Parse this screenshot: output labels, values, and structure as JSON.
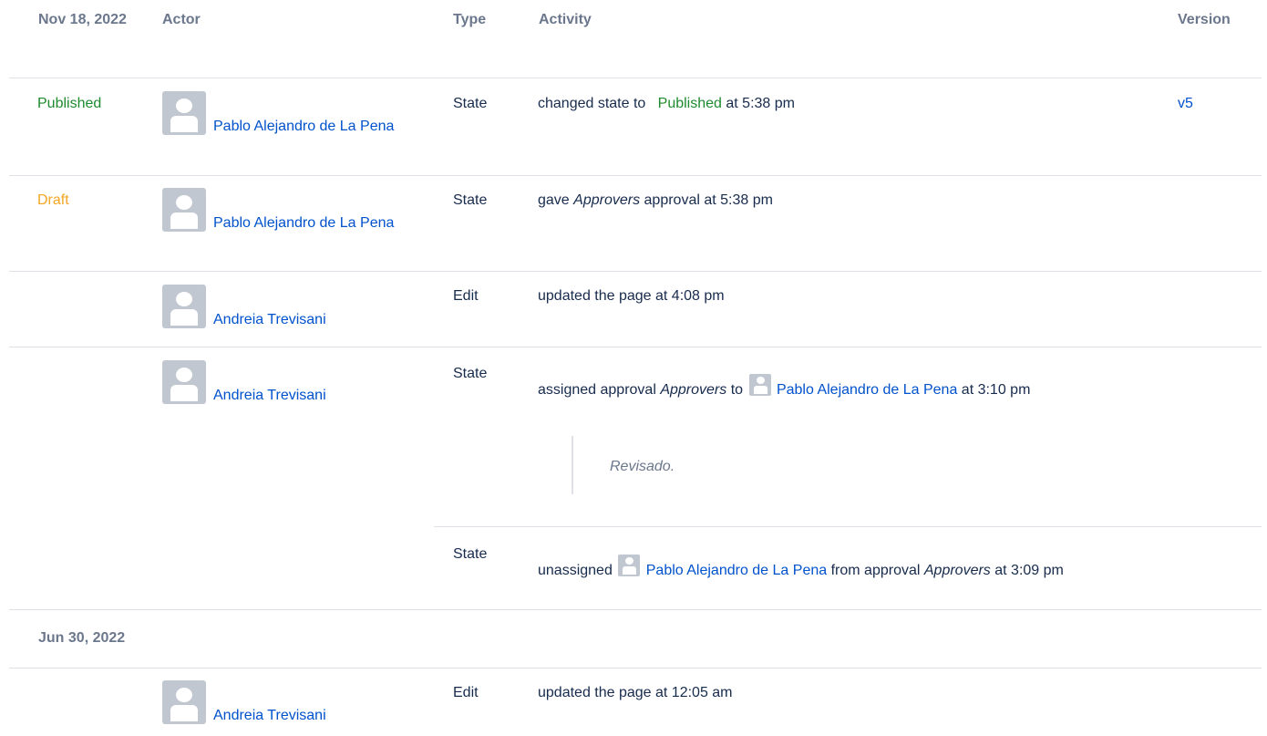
{
  "headers": {
    "date": "Nov 18, 2022",
    "actor": "Actor",
    "type": "Type",
    "activity": "Activity",
    "version": "Version"
  },
  "rows": [
    {
      "state": "Published",
      "actor": "Pablo Alejandro de La Pena",
      "type": "State",
      "activity_pre": "changed state to",
      "activity_state": "Published",
      "activity_post": "at 5:38 pm",
      "version": "v5"
    },
    {
      "state": "Draft",
      "actor": "Pablo Alejandro de La Pena",
      "type": "State",
      "activity_pre": "gave",
      "activity_em": "Approvers",
      "activity_post": "approval at 5:38 pm"
    },
    {
      "actor": "Andreia Trevisani",
      "type": "Edit",
      "activity": "updated the page at 4:08 pm"
    },
    {
      "actor": "Andreia Trevisani",
      "type": "State",
      "activity_pre": "assigned approval",
      "activity_em": "Approvers",
      "activity_mid": "to",
      "activity_user": "Pablo Alejandro de La Pena",
      "activity_post": "at 3:10 pm",
      "comment": "Revisado."
    },
    {
      "type": "State",
      "activity_pre": "unassigned",
      "activity_user": "Pablo Alejandro de La Pena",
      "activity_mid": "from approval",
      "activity_em": "Approvers",
      "activity_post": "at 3:09 pm"
    }
  ],
  "group2": {
    "date": "Jun 30, 2022",
    "rows": [
      {
        "actor": "Andreia Trevisani",
        "type": "Edit",
        "activity": "updated the page at 12:05 am"
      }
    ]
  },
  "colors": {
    "link": "#0052cc",
    "published": "#1e8a2e",
    "draft": "#f5a623",
    "header": "#6b778c",
    "divider": "#dfe1e6"
  }
}
